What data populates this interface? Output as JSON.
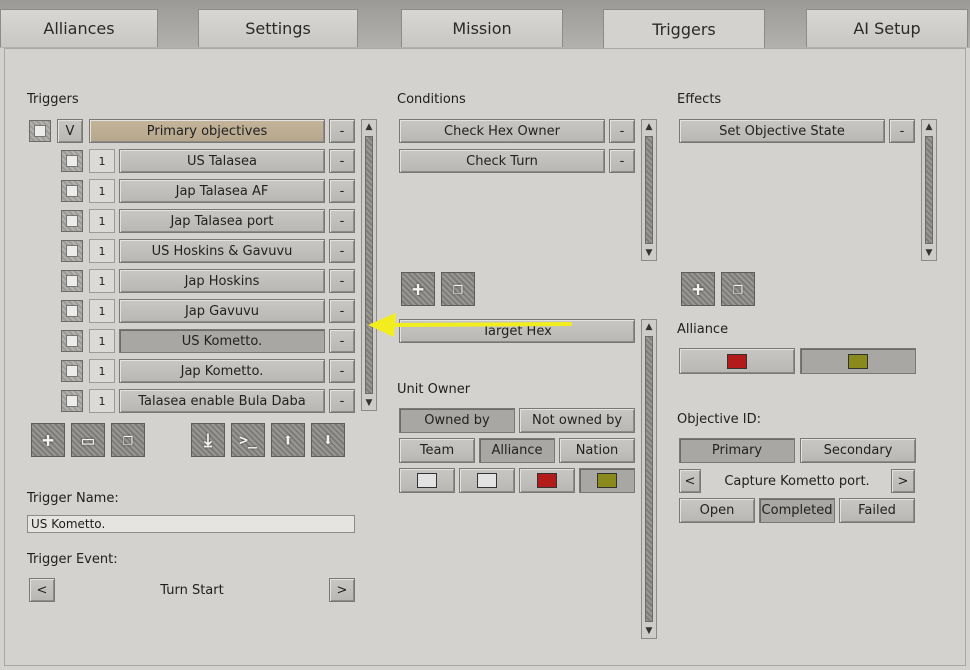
{
  "tabs": [
    "Alliances",
    "Settings",
    "Mission",
    "Triggers",
    "AI Setup"
  ],
  "active_tab": "Triggers",
  "triggers": {
    "title": "Triggers",
    "group": {
      "toggle": "V",
      "label": "Primary objectives",
      "remove": "-"
    },
    "items": [
      {
        "num": "1",
        "label": "US Talasea",
        "remove": "-"
      },
      {
        "num": "1",
        "label": "Jap Talasea AF",
        "remove": "-"
      },
      {
        "num": "1",
        "label": "Jap Talasea port",
        "remove": "-"
      },
      {
        "num": "1",
        "label": "US Hoskins & Gavuvu",
        "remove": "-"
      },
      {
        "num": "1",
        "label": "Jap Hoskins",
        "remove": "-"
      },
      {
        "num": "1",
        "label": "Jap Gavuvu",
        "remove": "-"
      },
      {
        "num": "1",
        "label": "US Kometto.",
        "remove": "-"
      },
      {
        "num": "1",
        "label": "Jap Kometto.",
        "remove": "-"
      },
      {
        "num": "1",
        "label": "Talasea enable Bula Daba",
        "remove": "-"
      }
    ],
    "selected_index": 6,
    "toolbar_icons": {
      "add": "+",
      "folder": "▭",
      "copy": "❐",
      "import": "⤓",
      "console": ">_",
      "up": "⬆",
      "down": "⬇"
    }
  },
  "trigger_name": {
    "label": "Trigger Name:",
    "value": "US Kometto."
  },
  "trigger_event": {
    "label": "Trigger Event:",
    "value": "Turn Start",
    "prev": "<",
    "next": ">"
  },
  "conditions": {
    "title": "Conditions",
    "items": [
      {
        "label": "Check Hex Owner",
        "remove": "-"
      },
      {
        "label": "Check Turn",
        "remove": "-"
      }
    ],
    "add": "+",
    "copy": "❐",
    "target_hex": "Target Hex",
    "unit_owner": {
      "title": "Unit Owner",
      "ownership": [
        "Owned by",
        "Not owned by"
      ],
      "ownership_selected": "Owned by",
      "scope": [
        "Team",
        "Alliance",
        "Nation"
      ],
      "scope_selected": "Alliance",
      "colors": [
        "#e2e2e2",
        "#e2e2e2",
        "#b31b1b",
        "#8a8a1c"
      ],
      "color_selected": 3
    }
  },
  "effects": {
    "title": "Effects",
    "items": [
      {
        "label": "Set Objective State",
        "remove": "-"
      }
    ],
    "add": "+",
    "copy": "❐",
    "alliance": {
      "title": "Alliance",
      "colors": [
        "#b31b1b",
        "#8a8a1c"
      ],
      "selected": 1
    },
    "objective": {
      "title": "Objective ID:",
      "types": [
        "Primary",
        "Secondary"
      ],
      "type_selected": "Primary",
      "prev": "<",
      "next": ">",
      "value": "Capture Kometto port.",
      "states": [
        "Open",
        "Completed",
        "Failed"
      ],
      "state_selected": "Completed"
    }
  },
  "annotation": {
    "color": "#f2ee1e"
  }
}
